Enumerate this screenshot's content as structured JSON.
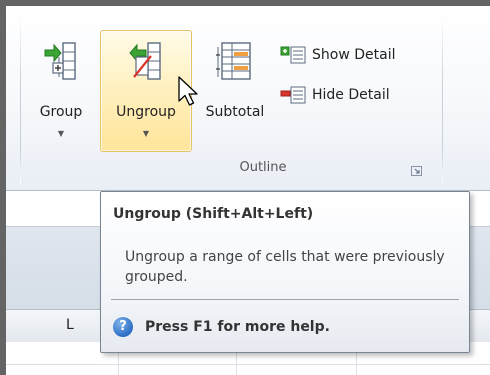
{
  "ribbon": {
    "group_button": {
      "label": "Group",
      "icon": "group-icon"
    },
    "ungroup_button": {
      "label": "Ungroup",
      "icon": "ungroup-icon",
      "state": "hovered"
    },
    "subtotal_button": {
      "label": "Subtotal",
      "icon": "subtotal-icon"
    },
    "show_detail": {
      "label": "Show Detail",
      "icon": "show-detail-icon"
    },
    "hide_detail": {
      "label": "Hide Detail",
      "icon": "hide-detail-icon"
    },
    "group_label": "Outline",
    "launcher_icon": "dialog-launcher-icon"
  },
  "sheet": {
    "column_header": "L"
  },
  "tooltip": {
    "title": "Ungroup (Shift+Alt+Left)",
    "body": "Ungroup a range of cells that were previously grouped.",
    "help_text": "Press F1 for more help.",
    "help_icon": "help-icon"
  },
  "colors": {
    "hover_border": "#e5c365",
    "hover_fill": "#ffe59a",
    "arrow_green": "#3aa535",
    "hide_red": "#d9342b",
    "help_blue": "#2d6ec4"
  }
}
